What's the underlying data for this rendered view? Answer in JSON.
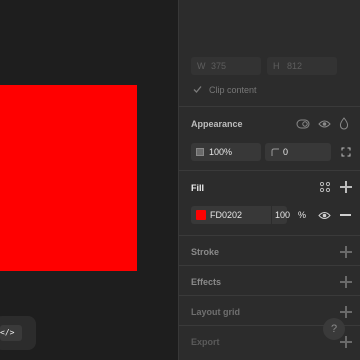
{
  "canvas": {
    "code_label": "</>"
  },
  "frame": {
    "w_label": "W",
    "w_value": "375",
    "h_label": "H",
    "h_value": "812",
    "clip_label": "Clip content"
  },
  "appearance": {
    "title": "Appearance",
    "opacity": "100%",
    "radius": "0"
  },
  "fill": {
    "title": "Fill",
    "color": "#FD0202",
    "hex": "FD0202",
    "opacity": "100",
    "unit": "%"
  },
  "sections": {
    "stroke": "Stroke",
    "effects": "Effects",
    "layout_grid": "Layout grid",
    "export": "Export"
  },
  "help_label": "?"
}
